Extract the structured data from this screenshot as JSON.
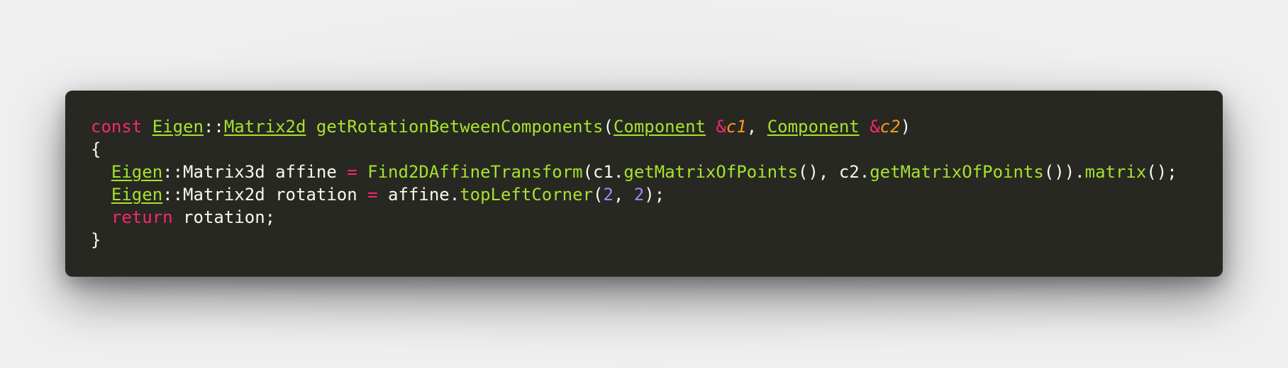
{
  "code": {
    "line1": {
      "kw_const": "const",
      "type_eigen": "Eigen",
      "sep1": "::",
      "type_matrix2d": "Matrix2d",
      "fn_name": "getRotationBetweenComponents",
      "paren_open": "(",
      "type_component1": "Component",
      "amp1": "&",
      "param_c1": "c1",
      "comma": ", ",
      "type_component2": "Component",
      "amp2": "&",
      "param_c2": "c2",
      "paren_close": ")"
    },
    "line2": {
      "brace_open": "{"
    },
    "line3": {
      "type_eigen": "Eigen",
      "rest_type": "::Matrix3d affine ",
      "op_assign": "=",
      "fn_find": "Find2DAffineTransform",
      "p1": "(c1.",
      "fn_getmatrix1": "getMatrixOfPoints",
      "p2": "(), c2.",
      "fn_getmatrix2": "getMatrixOfPoints",
      "p3": "()).",
      "fn_matrix": "matrix",
      "p4": "();"
    },
    "line4": {
      "type_eigen": "Eigen",
      "rest_type": "::Matrix2d rotation ",
      "op_assign": "=",
      "p1": " affine.",
      "fn_topleft": "topLeftCorner",
      "p2": "(",
      "num1": "2",
      "p3": ", ",
      "num2": "2",
      "p4": ");"
    },
    "line5": {
      "kw_return": "return",
      "rest": " rotation;"
    },
    "line6": {
      "brace_close": "}"
    }
  },
  "colors": {
    "background": "#272822",
    "keyword": "#f92672",
    "type": "#a6e22e",
    "function": "#a6e22e",
    "parameter": "#fd971f",
    "number": "#ae81ff",
    "text": "#f8f8f2"
  }
}
